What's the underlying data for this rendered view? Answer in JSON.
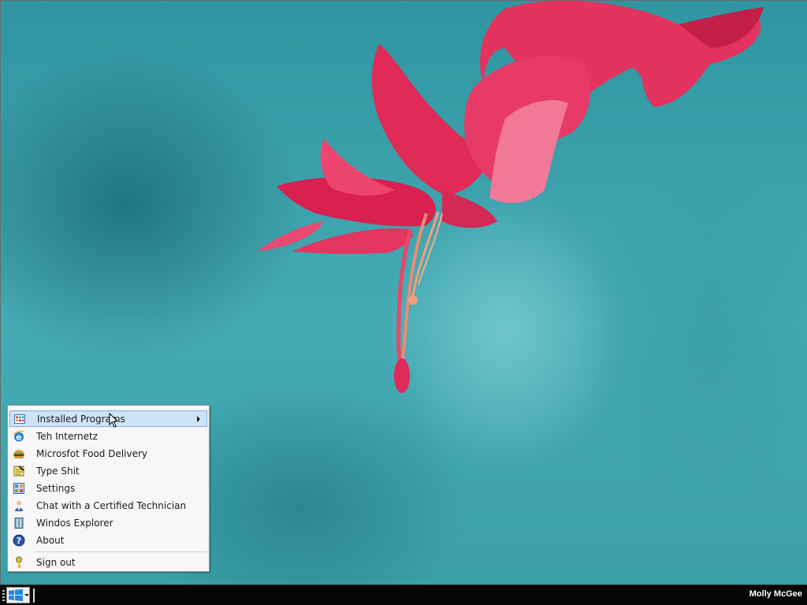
{
  "desktop": {
    "wallpaper": "pink-christmas-cactus-flower-on-teal",
    "accent_pink": "#e8245a",
    "accent_teal": "#3a9ea6"
  },
  "start_menu": {
    "items": [
      {
        "label": "Installed Programs",
        "icon": "installed-programs-icon",
        "has_submenu": true,
        "highlighted": true
      },
      {
        "label": "Teh Internetz",
        "icon": "internet-explorer-icon"
      },
      {
        "label": "Microsfot Food Delivery",
        "icon": "burger-icon"
      },
      {
        "label": "Type Shit",
        "icon": "notepad-icon"
      },
      {
        "label": "Settings",
        "icon": "settings-panel-icon"
      },
      {
        "label": "Chat with a Certified Technician",
        "icon": "technician-person-icon"
      },
      {
        "label": "Windos Explorer",
        "icon": "explorer-icon"
      },
      {
        "label": "About",
        "icon": "help-question-icon"
      }
    ],
    "sign_out": {
      "label": "Sign out",
      "icon": "key-icon"
    },
    "highlight_color": "#cfe3f7"
  },
  "taskbar": {
    "start_icon": "windows-logo-icon",
    "user_name": "Molly McGee"
  }
}
